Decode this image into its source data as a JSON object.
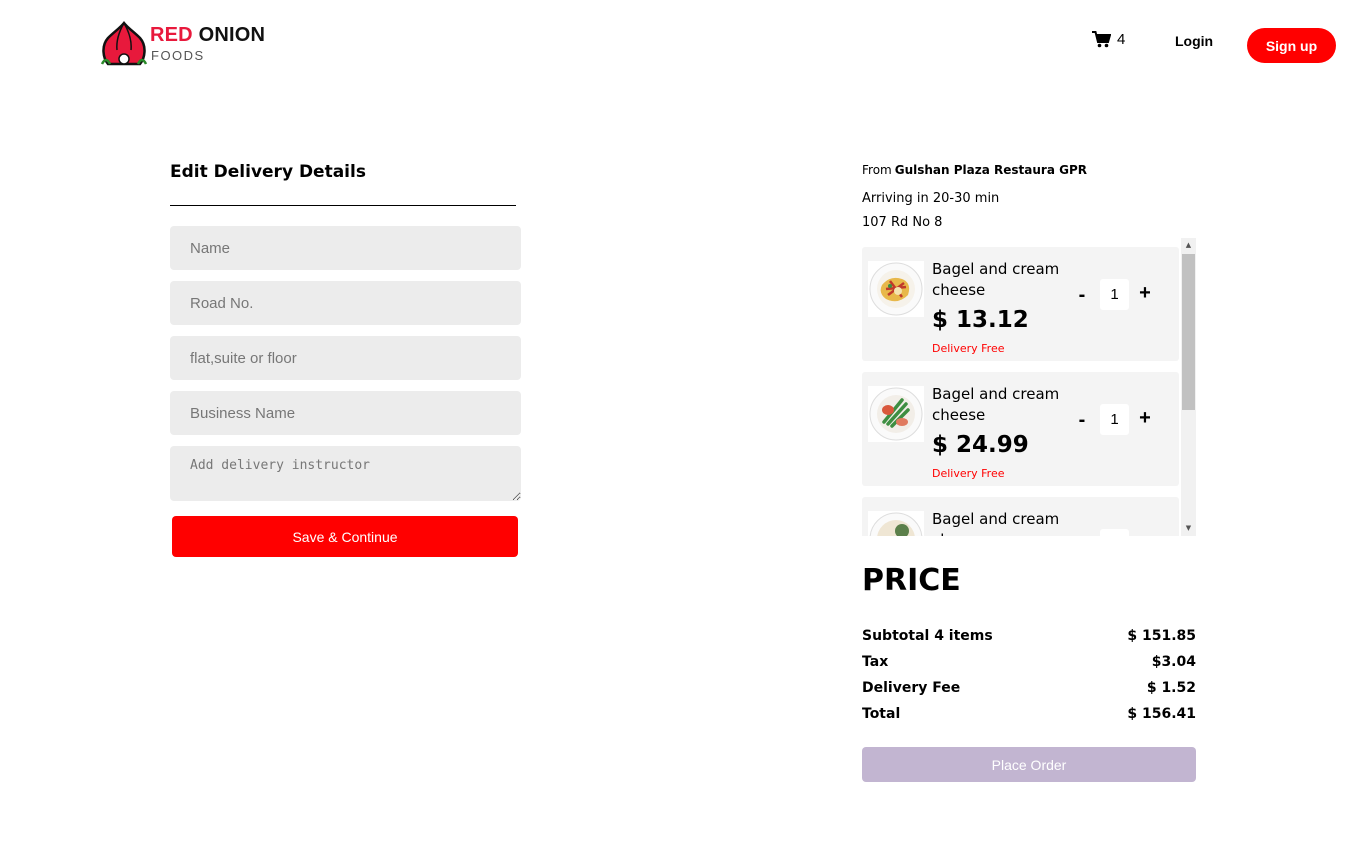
{
  "header": {
    "logo_red": "RED",
    "logo_onion": "ONION",
    "logo_foods": "FOODS",
    "cart_count": "4",
    "login_label": "Login",
    "signup_label": "Sign up",
    "accent_color": "#ff0000"
  },
  "form": {
    "title": "Edit Delivery Details",
    "name_placeholder": "Name",
    "road_placeholder": "Road No.",
    "flat_placeholder": "flat,suite or floor",
    "business_placeholder": "Business Name",
    "instructions_placeholder": "Add delivery instructor",
    "save_label": "Save & Continue"
  },
  "order": {
    "from_label": "From",
    "restaurant": "Gulshan Plaza Restaura GPR",
    "arriving": "Arriving in 20-30 min",
    "address": "107 Rd No 8",
    "items": [
      {
        "name": "Bagel and cream cheese",
        "price": "$ 13.12",
        "delivery": "Delivery Free",
        "quantity": "1",
        "minus": "-",
        "plus": "+"
      },
      {
        "name": "Bagel and cream cheese",
        "price": "$ 24.99",
        "delivery": "Delivery Free",
        "quantity": "1",
        "minus": "-",
        "plus": "+"
      },
      {
        "name": "Bagel and cream cheese",
        "price": "",
        "delivery": "",
        "quantity": "",
        "minus": "",
        "plus": ""
      }
    ]
  },
  "price": {
    "title": "PRICE",
    "rows": [
      {
        "label": "Subtotal 4 items",
        "value": "$ 151.85"
      },
      {
        "label": "Tax",
        "value": "$3.04"
      },
      {
        "label": "Delivery Fee",
        "value": "$ 1.52"
      },
      {
        "label": "Total",
        "value": "$ 156.41"
      }
    ],
    "place_order_label": "Place Order"
  }
}
